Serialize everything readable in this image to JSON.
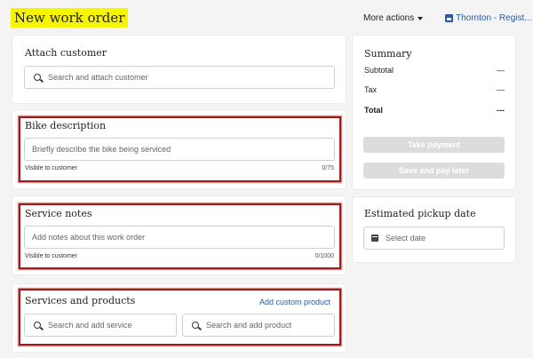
{
  "header": {
    "title": "New work order",
    "more_actions_label": "More actions",
    "location_label": "Thornton - Regist..."
  },
  "customer": {
    "heading": "Attach customer",
    "search_placeholder": "Search and attach customer"
  },
  "bike": {
    "heading": "Bike description",
    "placeholder": "Briefly describe the bike being serviced",
    "visibility_hint": "Visible to customer",
    "counter": "0/75"
  },
  "service_notes": {
    "heading": "Service notes",
    "placeholder": "Add notes about this work order",
    "visibility_hint": "Visible to customer",
    "counter": "0/1000"
  },
  "services_products": {
    "heading": "Services and products",
    "add_custom_link": "Add custom product",
    "service_search_placeholder": "Search and add service",
    "product_search_placeholder": "Search and add product"
  },
  "summary": {
    "title": "Summary",
    "rows": [
      {
        "label": "Subtotal",
        "value": "—"
      },
      {
        "label": "Tax",
        "value": "—"
      },
      {
        "label": "Total",
        "value": "---"
      }
    ],
    "take_payment_label": "Take payment",
    "save_pay_later_label": "Save and pay later"
  },
  "pickup": {
    "heading": "Estimated pickup date",
    "placeholder": "Select date"
  },
  "colors": {
    "highlight": "#f5f500",
    "link": "#2a5aa5",
    "annotation_border": "#a11a1a",
    "disabled_button": "#dcdcdc"
  }
}
